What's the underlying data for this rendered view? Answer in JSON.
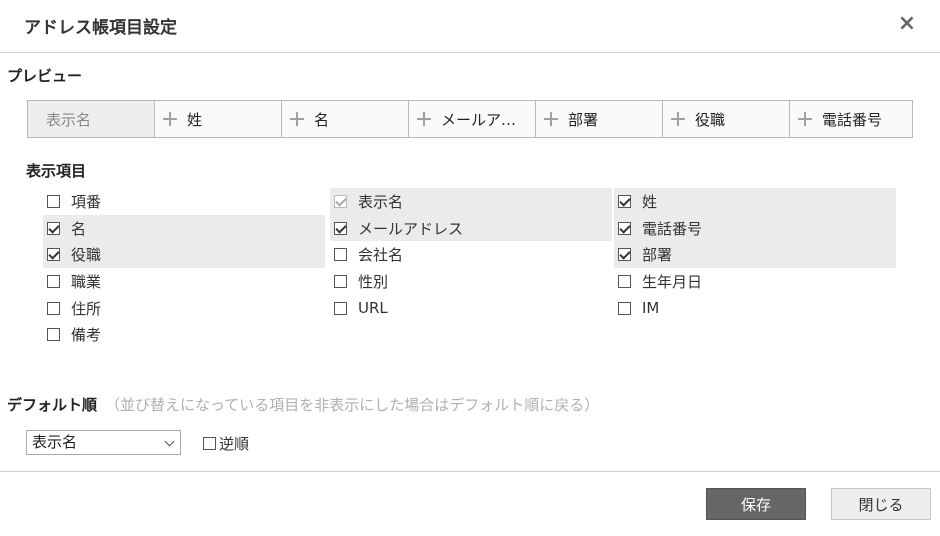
{
  "dialog": {
    "title": "アドレス帳項目設定",
    "close_label": "×"
  },
  "preview": {
    "heading": "プレビュー",
    "columns": [
      "表示名",
      "姓",
      "名",
      "メールア…",
      "部署",
      "役職",
      "電話番号"
    ]
  },
  "items": {
    "heading": "表示項目",
    "columns": [
      [
        {
          "label": "項番",
          "checked": false,
          "highlighted": false,
          "disabled": false
        },
        {
          "label": "名",
          "checked": true,
          "highlighted": true,
          "disabled": false
        },
        {
          "label": "役職",
          "checked": true,
          "highlighted": true,
          "disabled": false
        },
        {
          "label": "職業",
          "checked": false,
          "highlighted": false,
          "disabled": false
        },
        {
          "label": "住所",
          "checked": false,
          "highlighted": false,
          "disabled": false
        },
        {
          "label": "備考",
          "checked": false,
          "highlighted": false,
          "disabled": false
        }
      ],
      [
        {
          "label": "表示名",
          "checked": true,
          "highlighted": true,
          "disabled": true
        },
        {
          "label": "メールアドレス",
          "checked": true,
          "highlighted": true,
          "disabled": false
        },
        {
          "label": "会社名",
          "checked": false,
          "highlighted": false,
          "disabled": false
        },
        {
          "label": "性別",
          "checked": false,
          "highlighted": false,
          "disabled": false
        },
        {
          "label": "URL",
          "checked": false,
          "highlighted": false,
          "disabled": false
        }
      ],
      [
        {
          "label": "姓",
          "checked": true,
          "highlighted": true,
          "disabled": false
        },
        {
          "label": "電話番号",
          "checked": true,
          "highlighted": true,
          "disabled": false
        },
        {
          "label": "部署",
          "checked": true,
          "highlighted": true,
          "disabled": false
        },
        {
          "label": "生年月日",
          "checked": false,
          "highlighted": false,
          "disabled": false
        },
        {
          "label": "IM",
          "checked": false,
          "highlighted": false,
          "disabled": false
        }
      ]
    ]
  },
  "default_order": {
    "heading": "デフォルト順",
    "hint": "（並び替えになっている項目を非表示にした場合はデフォルト順に戻る）",
    "selected": "表示名",
    "reverse_label": "逆順",
    "reverse_checked": false
  },
  "buttons": {
    "save": "保存",
    "close": "閉じる"
  }
}
